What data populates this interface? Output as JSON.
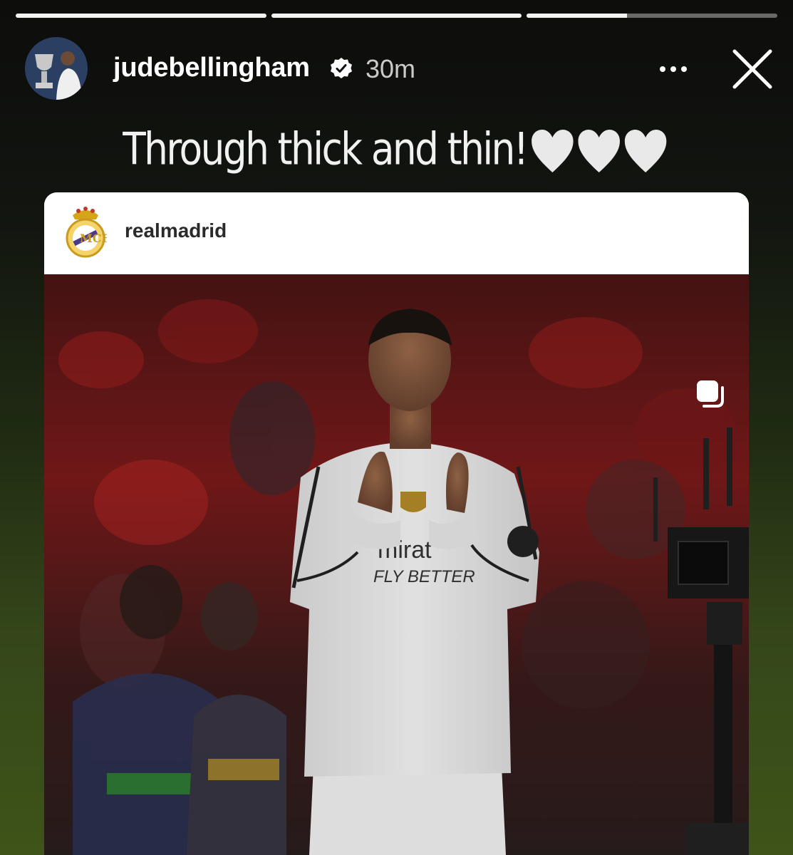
{
  "story": {
    "segments": [
      {
        "progress": 1
      },
      {
        "progress": 1
      },
      {
        "progress": 0.4
      }
    ],
    "account": {
      "username": "judebellingham",
      "time": "30m",
      "verified": true
    },
    "caption": "Through thick and thin!",
    "caption_emoji": [
      "white-heart",
      "white-heart",
      "white-heart"
    ],
    "icons": {
      "more": "more-horizontal-icon",
      "close": "close-icon",
      "verified": "verified-badge-icon"
    }
  },
  "shared_post": {
    "account": "realmadrid",
    "multi_image_indicator": "carousel-icon"
  },
  "colors": {
    "background_top": "#0d0d0c",
    "background_bottom": "#3e5418",
    "verified_badge": "#ffffff"
  }
}
